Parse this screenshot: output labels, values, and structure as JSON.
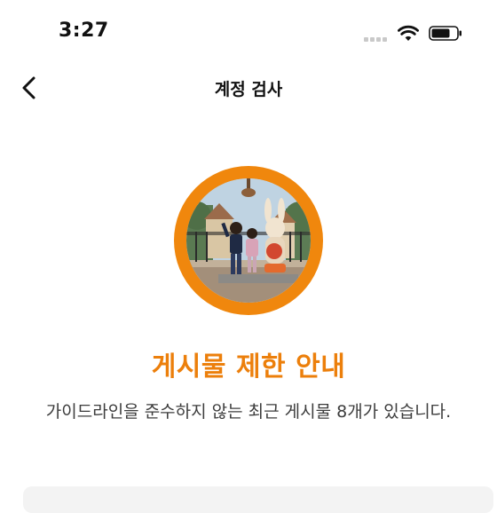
{
  "status_bar": {
    "time": "3:27",
    "icons": [
      "signal-icon",
      "wifi-icon",
      "battery-icon"
    ]
  },
  "nav": {
    "back_icon": "chevron-left-icon",
    "title": "계정 검사"
  },
  "notice": {
    "image": "profile-photo",
    "ring_color": "#f0870d",
    "title": "게시물 제한 안내",
    "title_color": "#ec7f0b",
    "message": "가이드라인을 준수하지 않는 최근 게시물 8개가 있습니다."
  }
}
